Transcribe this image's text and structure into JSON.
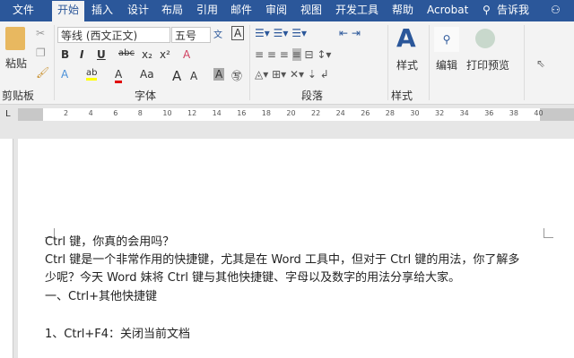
{
  "tabs": [
    "文件",
    "开始",
    "插入",
    "设计",
    "布局",
    "引用",
    "邮件",
    "审阅",
    "视图",
    "开发工具",
    "帮助",
    "Acrobat",
    "告诉我"
  ],
  "active_tab": "开始",
  "clipboard": {
    "paste": "粘贴",
    "group": "剪贴板"
  },
  "font": {
    "name": "等线 (西文正文)",
    "size": "五号",
    "group": "字体",
    "aa": "Aa"
  },
  "paragraph": {
    "group": "段落"
  },
  "styles": {
    "label": "样式",
    "group": "样式"
  },
  "editing": {
    "label": "编辑"
  },
  "print_preview": {
    "label": "打印预览"
  },
  "ruler": [
    "2",
    "4",
    "6",
    "8",
    "10",
    "12",
    "14",
    "16",
    "18",
    "20",
    "22",
    "24",
    "26",
    "28",
    "30",
    "32",
    "34",
    "36",
    "38",
    "40"
  ],
  "colors": {
    "accent": "#2b579a",
    "highlight": "#ffff00",
    "font_color": "#e00000"
  },
  "document": {
    "lines": [
      "Ctrl 键，你真的会用吗？",
      "Ctrl 键是一个非常作用的快捷键，尤其是在 Word 工具中，但对于 Ctrl 键的用法，你了解多",
      "少呢？今天 Word 妹将 Ctrl 键与其他快捷键、字母以及数字的用法分享给大家。",
      "一、Ctrl+其他快捷键",
      "1、Ctrl+F4：关闭当前文档"
    ]
  }
}
